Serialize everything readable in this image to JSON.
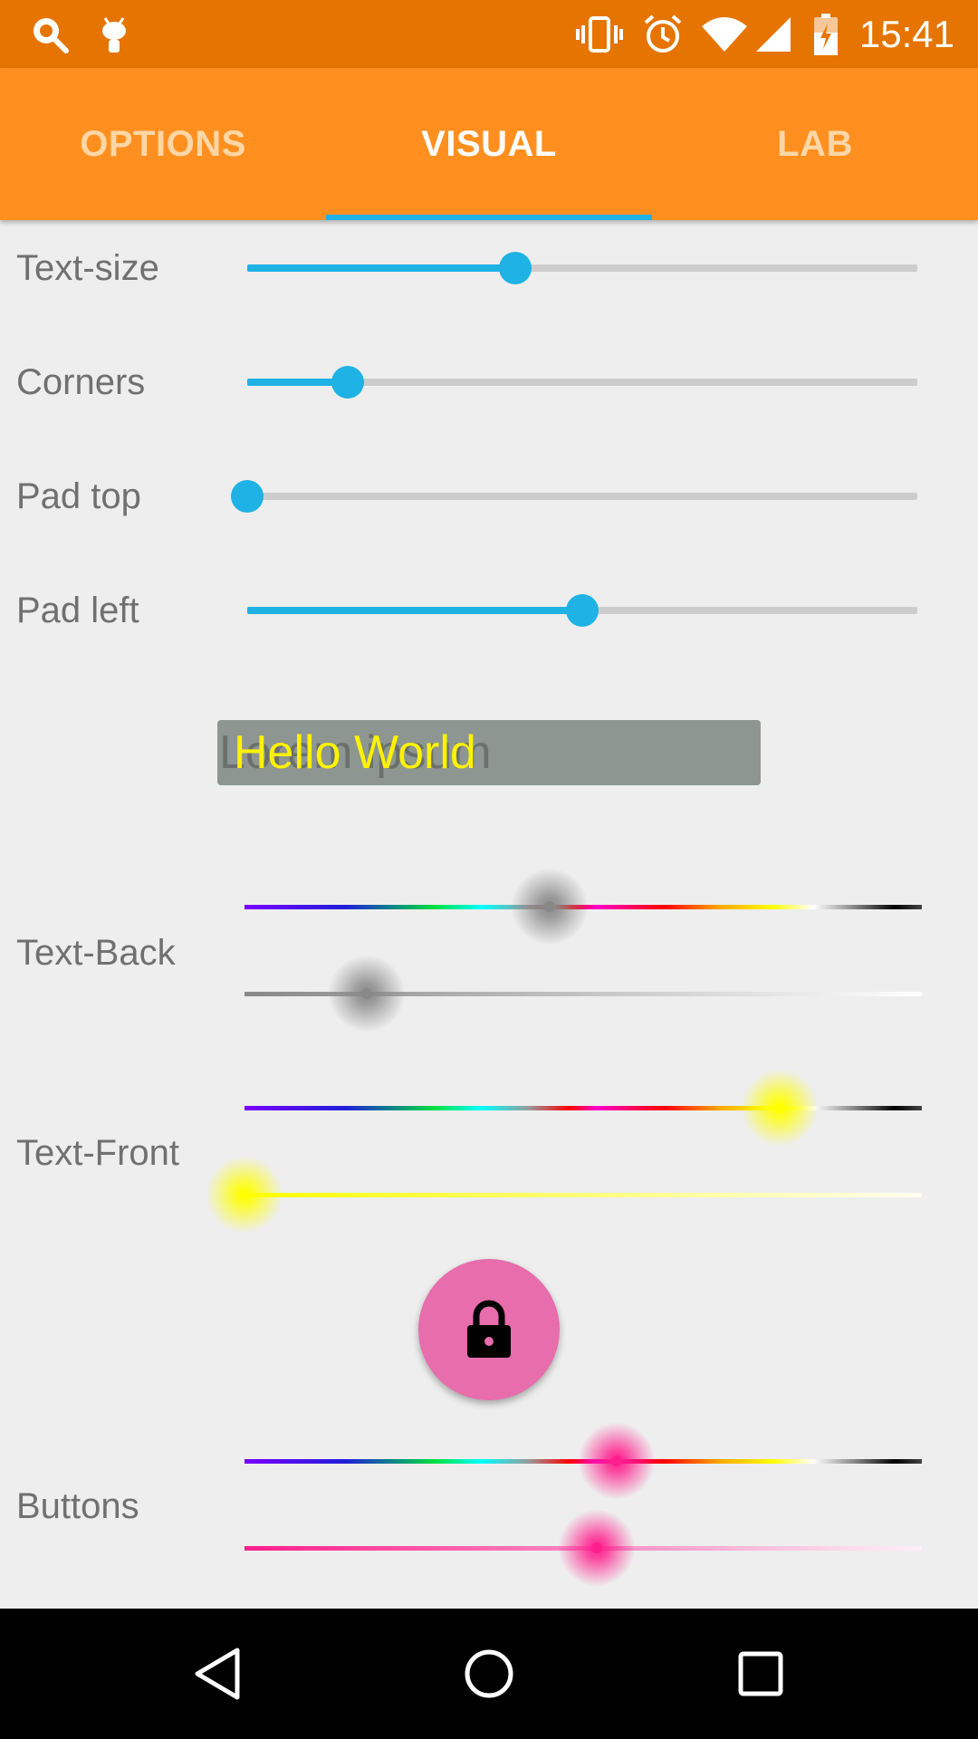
{
  "status_bar": {
    "time": "15:41",
    "icons_left": [
      "search-app-icon",
      "android-debug-icon"
    ],
    "icons_right": [
      "vibrate-icon",
      "alarm-icon",
      "wifi-icon",
      "cell-signal-icon",
      "battery-charging-icon"
    ]
  },
  "tabs": [
    {
      "label": "OPTIONS",
      "active": false
    },
    {
      "label": "VISUAL",
      "active": true
    },
    {
      "label": "LAB",
      "active": false
    }
  ],
  "settings": {
    "text_size": {
      "label": "Text-size",
      "value_pct": 40
    },
    "corners": {
      "label": "Corners",
      "value_pct": 15
    },
    "pad_top": {
      "label": "Pad top",
      "value_pct": 0
    },
    "pad_left": {
      "label": "Pad left",
      "value_pct": 50
    }
  },
  "preview": {
    "hint": "Lorem ipsum",
    "text": "Hello World",
    "text_color": "#fff200",
    "background_color": "#8d9691"
  },
  "color_controls": {
    "text_back": {
      "label": "Text-Back",
      "hue_pct": 45,
      "shade_pct": 18,
      "color": "#888888"
    },
    "text_front": {
      "label": "Text-Front",
      "hue_pct": 79,
      "shade_pct": 0,
      "color": "#ffff00"
    },
    "buttons": {
      "label": "Buttons",
      "hue_pct": 55,
      "shade_pct": 52,
      "color": "#ff1e8c"
    }
  },
  "fab": {
    "icon": "lock-icon",
    "color": "#e76dac"
  },
  "colors": {
    "accent": "#1fb2e4",
    "status_bar": "#e57400",
    "tab_bar": "#ff9020"
  },
  "nav": {
    "icons": [
      "back-icon",
      "home-icon",
      "recents-icon"
    ]
  }
}
